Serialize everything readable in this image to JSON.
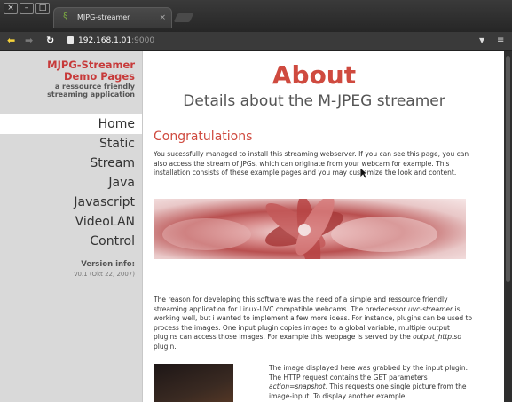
{
  "browser": {
    "tab_title": "MJPG-streamer",
    "tab_close": "×",
    "url_host": "192.168.1.01",
    "url_port": ":9000",
    "window_controls": [
      "×",
      "–",
      "□"
    ]
  },
  "sidebar": {
    "brand_line1": "MJPG-Streamer",
    "brand_line2": "Demo Pages",
    "brand_line3": "a ressource friendly",
    "brand_line4": "streaming application",
    "menu": [
      "Home",
      "Static",
      "Stream",
      "Java",
      "Javascript",
      "VideoLAN",
      "Control"
    ],
    "active_item": "Home",
    "version_label": "Version info:",
    "version_value": "v0.1 (Okt 22, 2007)"
  },
  "content": {
    "title": "About",
    "subtitle": "Details about the M-JPEG streamer",
    "heading": "Congratulations",
    "para1": "You sucessfully managed to install this streaming webserver. If you can see this page, you can also access the stream of JPGs, which can originate from your webcam for example. This installation consists of these example pages and you may customize the look and content.",
    "para2_a": "The reason for developing this software was the need of a simple and ressource friendly streaming application for Linux-UVC compatible webcams. The predecessor ",
    "para2_b": "uvc-streamer",
    "para2_c": " is working well, but i wanted to implement a few more ideas. For instance, plugins can be used to process the images. One input plugin copies images to a global variable, multiple output plugins can access those images. For example this webpage is served by the ",
    "para2_d": "output_http.so",
    "para2_e": " plugin.",
    "para3_a": "The image displayed here was grabbed by the input plugin. The HTTP request contains the GET parameters ",
    "para3_b": "action=snapshot",
    "para3_c": ". This requests one single picture from the image-input. To display another example,"
  },
  "icons": {
    "back": "arrow-left-icon",
    "forward": "arrow-right-icon",
    "reload": "reload-icon",
    "menu": "hamburger-menu-icon"
  }
}
